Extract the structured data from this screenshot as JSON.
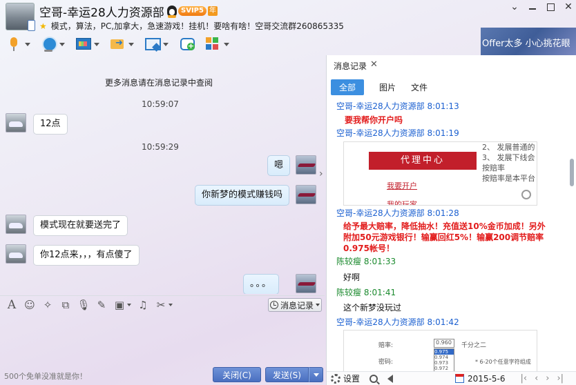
{
  "window": {
    "title": "空哥-幸运28人力资源部",
    "vip_badge": "SVIP5",
    "vip_year": "年",
    "signature": "模式，算法，PC,加拿大，急速游戏！挂机！要啥有啥！空哥交流群260865335"
  },
  "banner_text": "Offer太多  小心挑花眼",
  "chat": {
    "more_hint": "更多消息请在消息记录中查阅",
    "messages": [
      {
        "type": "time",
        "text": "10:59:07"
      },
      {
        "type": "in",
        "text": "12点"
      },
      {
        "type": "time",
        "text": "10:59:29"
      },
      {
        "type": "out",
        "text": "嗯"
      },
      {
        "type": "out",
        "text": "你新梦的模式赚钱吗"
      },
      {
        "type": "in",
        "text": "模式现在就要送完了"
      },
      {
        "type": "in",
        "text": "你12点来，，，有点傻了"
      },
      {
        "type": "out",
        "text": "。。。"
      }
    ]
  },
  "input": {
    "history_button": "消息记录",
    "tip": "500个免单没准就是你！",
    "close_button": "关闭(C)",
    "send_button": "发送(S)"
  },
  "history_panel": {
    "title": "消息记录",
    "tabs": [
      "全部",
      "图片",
      "文件"
    ],
    "entries": [
      {
        "sender": "空哥-幸运28人力资源部",
        "time": "8:01:13",
        "text": "要我帮你开户吗"
      },
      {
        "sender": "空哥-幸运28人力资源部",
        "time": "8:01:19"
      },
      {
        "sender": "空哥-幸运28人力资源部",
        "time": "8:01:28",
        "text": "给予最大赔率，降低抽水！充值送10%金币加成！另外附加50元游戏银行！输赢回红5%！输赢200调节赔率0.975帐号！"
      },
      {
        "sender": "陈较瘦",
        "time": "8:01:33",
        "text": "好啊"
      },
      {
        "sender": "陈较瘦",
        "time": "8:01:41",
        "text": "这个新梦没玩过"
      },
      {
        "sender": "空哥-幸运28人力资源部",
        "time": "8:01:42"
      }
    ],
    "image1": {
      "button_text": "代理中心",
      "link1": "我要开户",
      "link2": "我的玩家",
      "side_lines": [
        "2、 发展普通的",
        "3、 发展下线会",
        "按赔率",
        "按赔率是本平台"
      ]
    },
    "image2": {
      "label1": "赔率:",
      "label2": "密码:",
      "selected": "0.960",
      "options": [
        "0.975",
        "0.974",
        "0.973",
        "0.972"
      ],
      "half_label": "千分之二",
      "hint": "* 6-20个任意字符组成"
    },
    "settings_label": "设置",
    "date": "2015-5-6"
  }
}
